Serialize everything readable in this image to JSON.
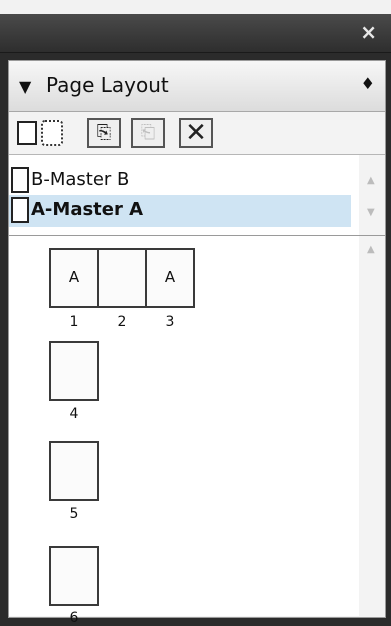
{
  "window": {
    "close_glyph": "×"
  },
  "panel": {
    "title": "Page Layout",
    "collapse_glyph": "▼",
    "menu_glyph": "♦"
  },
  "toolbar": {
    "new_page_icon": "new-page-icon",
    "new_master_icon": "new-master-icon",
    "duplicate_glyph": "⎘",
    "load_glyph": "⎗",
    "delete_glyph": "✕"
  },
  "masters": {
    "items": [
      {
        "label": "B-Master B",
        "selected": false
      },
      {
        "label": "A-Master A",
        "selected": true
      }
    ]
  },
  "spread": {
    "pages": [
      {
        "number": "1",
        "master": "A"
      },
      {
        "number": "2",
        "master": ""
      },
      {
        "number": "3",
        "master": "A"
      }
    ]
  },
  "single_pages": [
    {
      "number": "4"
    },
    {
      "number": "5"
    },
    {
      "number": "6"
    }
  ],
  "scroll": {
    "up": "▲",
    "down": "▼"
  },
  "colors": {
    "selection": "#cfe4f3",
    "titlebar": "#3a3a3a"
  }
}
